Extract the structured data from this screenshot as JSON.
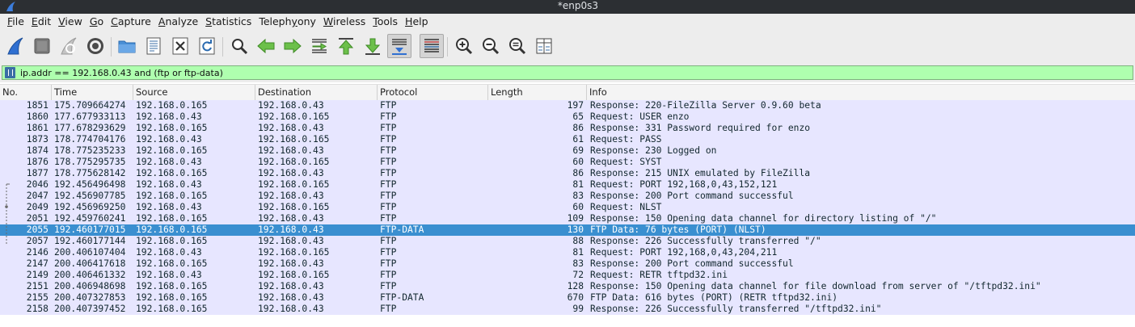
{
  "window": {
    "title": "*enp0s3"
  },
  "menu": [
    {
      "label": "File",
      "ul": "F",
      "rest": "ile"
    },
    {
      "label": "Edit",
      "ul": "E",
      "rest": "dit"
    },
    {
      "label": "View",
      "ul": "V",
      "rest": "iew"
    },
    {
      "label": "Go",
      "ul": "G",
      "rest": "o"
    },
    {
      "label": "Capture",
      "ul": "C",
      "rest": "apture"
    },
    {
      "label": "Analyze",
      "ul": "A",
      "rest": "nalyze"
    },
    {
      "label": "Statistics",
      "ul": "S",
      "rest": "tatistics"
    },
    {
      "label": "Telephony",
      "ul": "y",
      "pre": "Teleph",
      "rest2": "ony"
    },
    {
      "label": "Wireless",
      "ul": "W",
      "rest": "ireless"
    },
    {
      "label": "Tools",
      "ul": "T",
      "rest": "ools"
    },
    {
      "label": "Help",
      "ul": "H",
      "rest": "elp"
    }
  ],
  "toolbar": {
    "icons": [
      "start-capture-icon",
      "stop-capture-icon",
      "restart-capture-icon",
      "capture-options-icon",
      "open-file-icon",
      "file-set-icon",
      "close-file-icon",
      "reload-file-icon",
      "find-packet-icon",
      "go-back-icon",
      "go-forward-icon",
      "go-to-packet-icon",
      "first-packet-icon",
      "last-packet-icon",
      "auto-scroll-icon",
      "colorize-icon",
      "zoom-in-icon",
      "zoom-out-icon",
      "normal-size-icon",
      "resize-columns-icon"
    ]
  },
  "filter": {
    "value": "ip.addr == 192.168.0.43 and (ftp or ftp-data)"
  },
  "columns": [
    "No.",
    "Time",
    "Source",
    "Destination",
    "Protocol",
    "Length",
    "Info"
  ],
  "packets": [
    {
      "no": "1851",
      "time": "175.709664274",
      "src": "192.168.0.165",
      "dst": "192.168.0.43",
      "proto": "FTP",
      "len": "197",
      "info": "Response: 220-FileZilla Server 0.9.60 beta"
    },
    {
      "no": "1860",
      "time": "177.677933113",
      "src": "192.168.0.43",
      "dst": "192.168.0.165",
      "proto": "FTP",
      "len": "65",
      "info": "Request: USER enzo"
    },
    {
      "no": "1861",
      "time": "177.678293629",
      "src": "192.168.0.165",
      "dst": "192.168.0.43",
      "proto": "FTP",
      "len": "86",
      "info": "Response: 331 Password required for enzo"
    },
    {
      "no": "1873",
      "time": "178.774704176",
      "src": "192.168.0.43",
      "dst": "192.168.0.165",
      "proto": "FTP",
      "len": "61",
      "info": "Request: PASS"
    },
    {
      "no": "1874",
      "time": "178.775235233",
      "src": "192.168.0.165",
      "dst": "192.168.0.43",
      "proto": "FTP",
      "len": "69",
      "info": "Response: 230 Logged on"
    },
    {
      "no": "1876",
      "time": "178.775295735",
      "src": "192.168.0.43",
      "dst": "192.168.0.165",
      "proto": "FTP",
      "len": "60",
      "info": "Request: SYST"
    },
    {
      "no": "1877",
      "time": "178.775628142",
      "src": "192.168.0.165",
      "dst": "192.168.0.43",
      "proto": "FTP",
      "len": "86",
      "info": "Response: 215 UNIX emulated by FileZilla"
    },
    {
      "no": "2046",
      "time": "192.456496498",
      "src": "192.168.0.43",
      "dst": "192.168.0.165",
      "proto": "FTP",
      "len": "81",
      "info": "Request: PORT 192,168,0,43,152,121"
    },
    {
      "no": "2047",
      "time": "192.456907785",
      "src": "192.168.0.165",
      "dst": "192.168.0.43",
      "proto": "FTP",
      "len": "83",
      "info": "Response: 200 Port command successful"
    },
    {
      "no": "2049",
      "time": "192.456969250",
      "src": "192.168.0.43",
      "dst": "192.168.0.165",
      "proto": "FTP",
      "len": "60",
      "info": "Request: NLST"
    },
    {
      "no": "2051",
      "time": "192.459760241",
      "src": "192.168.0.165",
      "dst": "192.168.0.43",
      "proto": "FTP",
      "len": "109",
      "info": "Response: 150 Opening data channel for directory listing of \"/\""
    },
    {
      "no": "2055",
      "time": "192.460177015",
      "src": "192.168.0.165",
      "dst": "192.168.0.43",
      "proto": "FTP-DATA",
      "len": "130",
      "info": "FTP Data: 76 bytes (PORT) (NLST)",
      "selected": true
    },
    {
      "no": "2057",
      "time": "192.460177144",
      "src": "192.168.0.165",
      "dst": "192.168.0.43",
      "proto": "FTP",
      "len": "88",
      "info": "Response: 226 Successfully transferred \"/\""
    },
    {
      "no": "2146",
      "time": "200.406107404",
      "src": "192.168.0.43",
      "dst": "192.168.0.165",
      "proto": "FTP",
      "len": "81",
      "info": "Request: PORT 192,168,0,43,204,211"
    },
    {
      "no": "2147",
      "time": "200.406417618",
      "src": "192.168.0.165",
      "dst": "192.168.0.43",
      "proto": "FTP",
      "len": "83",
      "info": "Response: 200 Port command successful"
    },
    {
      "no": "2149",
      "time": "200.406461332",
      "src": "192.168.0.43",
      "dst": "192.168.0.165",
      "proto": "FTP",
      "len": "72",
      "info": "Request: RETR tftpd32.ini"
    },
    {
      "no": "2151",
      "time": "200.406948698",
      "src": "192.168.0.165",
      "dst": "192.168.0.43",
      "proto": "FTP",
      "len": "128",
      "info": "Response: 150 Opening data channel for file download from server of \"/tftpd32.ini\""
    },
    {
      "no": "2155",
      "time": "200.407327853",
      "src": "192.168.0.165",
      "dst": "192.168.0.43",
      "proto": "FTP-DATA",
      "len": "670",
      "info": "FTP Data: 616 bytes (PORT) (RETR tftpd32.ini)"
    },
    {
      "no": "2158",
      "time": "200.407397452",
      "src": "192.168.0.165",
      "dst": "192.168.0.43",
      "proto": "FTP",
      "len": "99",
      "info": "Response: 226 Successfully transferred \"/tftpd32.ini\""
    }
  ],
  "colors": {
    "row_bg": "#e7e6ff",
    "row_text": "#12272e",
    "selected_bg": "#3a8fd0",
    "filter_valid_bg": "#afffaf",
    "title_bar_bg": "#2c2f33"
  }
}
